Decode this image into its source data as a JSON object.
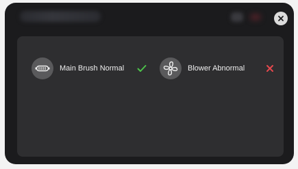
{
  "dialog": {
    "close_icon": "close-icon"
  },
  "components": [
    {
      "label": "Main Brush Normal",
      "icon": "main-brush-icon",
      "status": "normal",
      "status_icon": "check-icon",
      "status_color": "#4cc24a"
    },
    {
      "label": "Blower Abnormal",
      "icon": "blower-fan-icon",
      "status": "abnormal",
      "status_icon": "cross-icon",
      "status_color": "#e5484d"
    }
  ],
  "colors": {
    "dialog_bg": "#1b1b1d",
    "panel_bg": "#2e2e30",
    "icon_circle": "#5a5a5c",
    "text": "#f0f0f0"
  }
}
